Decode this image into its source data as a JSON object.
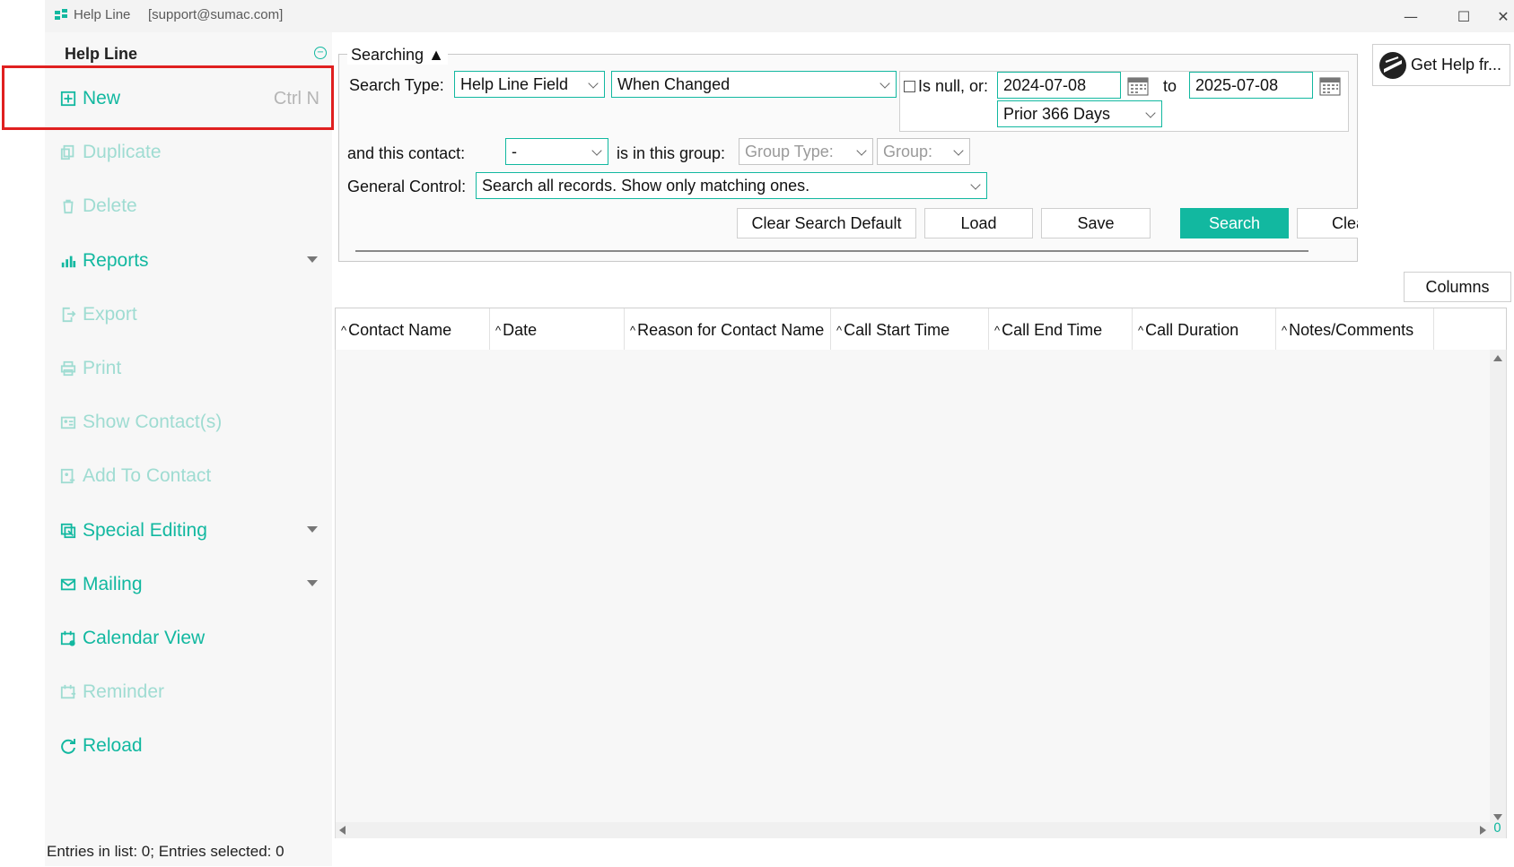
{
  "window": {
    "title": "Help Line",
    "account": "[support@sumac.com]",
    "minimize": "—",
    "maximize": "☐",
    "close": "✕"
  },
  "sidebar": {
    "header": "Help Line",
    "items": [
      {
        "label": "New",
        "shortcut": "Ctrl N",
        "state": "active",
        "icon": "plus-square-icon"
      },
      {
        "label": "Duplicate",
        "state": "disabled",
        "icon": "duplicate-icon"
      },
      {
        "label": "Delete",
        "state": "disabled",
        "icon": "trash-icon"
      },
      {
        "label": "Reports",
        "state": "active",
        "icon": "bar-chart-icon",
        "has_menu": true
      },
      {
        "label": "Export",
        "state": "disabled",
        "icon": "export-icon"
      },
      {
        "label": "Print",
        "state": "disabled",
        "icon": "printer-icon"
      },
      {
        "label": "Show Contact(s)",
        "state": "disabled",
        "icon": "contact-card-icon"
      },
      {
        "label": "Add To Contact",
        "state": "disabled",
        "icon": "add-contact-icon"
      },
      {
        "label": "Special Editing",
        "state": "active",
        "icon": "special-edit-icon",
        "has_menu": true
      },
      {
        "label": "Mailing",
        "state": "active",
        "icon": "mail-icon",
        "has_menu": true
      },
      {
        "label": "Calendar View",
        "state": "active",
        "icon": "calendar-icon"
      },
      {
        "label": "Reminder",
        "state": "disabled",
        "icon": "reminder-icon"
      },
      {
        "label": "Reload",
        "state": "active",
        "icon": "reload-icon"
      }
    ],
    "status": "Entries in list: 0; Entries selected: 0"
  },
  "search": {
    "section_label": "Searching",
    "section_toggle": "▲",
    "search_type_label": "Search Type:",
    "search_type_value": "Help Line Field",
    "field_value": "When Changed",
    "is_null_label": "Is null, or:",
    "date_from": "2024-07-08",
    "to_label": "to",
    "date_to": "2025-07-08",
    "range_value": "Prior 366 Days",
    "contact_label": "and this contact:",
    "contact_value": "-",
    "group_label": "is in this group:",
    "group_type_placeholder": "Group Type:",
    "group_placeholder": "Group:",
    "general_control_label": "General Control:",
    "general_control_value": "Search all records. Show only matching ones.",
    "buttons": {
      "clear_default": "Clear Search Default",
      "load": "Load",
      "save": "Save",
      "search": "Search",
      "clear": "Clea"
    }
  },
  "help_button": "Get Help fr...",
  "columns_button": "Columns",
  "table": {
    "columns": [
      "Contact Name",
      "Date",
      "Reason for Contact Name",
      "Call Start Time",
      "Call End Time",
      "Call Duration",
      "Notes/Comments"
    ],
    "sort_glyph": "^",
    "row_count_badge": "0"
  },
  "colors": {
    "accent": "#12b8a0",
    "accent_disabled": "#9fdcd2",
    "highlight": "#e02020"
  }
}
